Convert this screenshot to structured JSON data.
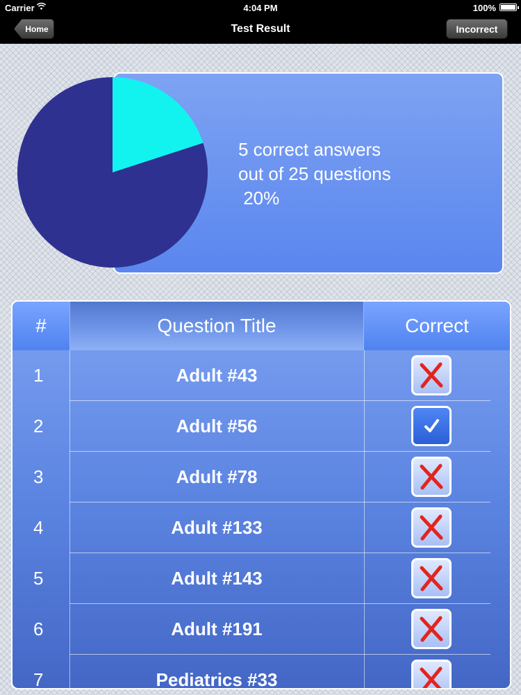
{
  "status_bar": {
    "carrier": "Carrier",
    "time": "4:04 PM",
    "battery": "100%"
  },
  "nav": {
    "back_label": "Home",
    "title": "Test Result",
    "right_button": "Incorrect"
  },
  "summary": {
    "line1": "5 correct answers",
    "line2": "out of 25 questions",
    "line3": " 20%",
    "correct": 5,
    "total": 25,
    "pie_colors": {
      "correct": "#12f3f0",
      "incorrect": "#2e3190"
    }
  },
  "table": {
    "columns": [
      "#",
      "Question Title",
      "Correct"
    ],
    "rows": [
      {
        "num": "1",
        "title": "Adult #43",
        "correct": false
      },
      {
        "num": "2",
        "title": "Adult #56",
        "correct": true
      },
      {
        "num": "3",
        "title": "Adult #78",
        "correct": false
      },
      {
        "num": "4",
        "title": "Adult #133",
        "correct": false
      },
      {
        "num": "5",
        "title": "Adult #143",
        "correct": false
      },
      {
        "num": "6",
        "title": "Adult #191",
        "correct": false
      },
      {
        "num": "7",
        "title": "Pediatrics #33",
        "correct": false
      }
    ],
    "icons": {
      "correct": "checkmark-icon",
      "incorrect": "x-mark-icon"
    },
    "x_color": "#e3241d"
  }
}
